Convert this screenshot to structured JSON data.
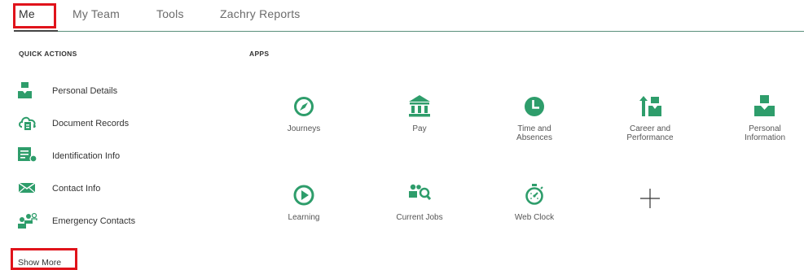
{
  "tabs": [
    {
      "label": "Me",
      "active": true
    },
    {
      "label": "My Team"
    },
    {
      "label": "Tools"
    },
    {
      "label": "Zachry Reports"
    }
  ],
  "accent_color": "#2e9d6b",
  "highlight_color": "#e0131b",
  "quick_actions": {
    "title": "QUICK ACTIONS",
    "items": [
      {
        "label": "Personal Details",
        "icon": "person-icon"
      },
      {
        "label": "Document Records",
        "icon": "cloud-document-icon"
      },
      {
        "label": "Identification Info",
        "icon": "id-card-icon"
      },
      {
        "label": "Contact Info",
        "icon": "envelope-icon"
      },
      {
        "label": "Emergency Contacts",
        "icon": "people-group-icon"
      }
    ],
    "show_more": "Show More"
  },
  "apps": {
    "title": "APPS",
    "items": [
      {
        "label": "Journeys",
        "icon": "compass-icon"
      },
      {
        "label": "Pay",
        "icon": "bank-icon"
      },
      {
        "label": "Time and\nAbsences",
        "icon": "clock-icon"
      },
      {
        "label": "Career and\nPerformance",
        "icon": "career-arrow-person-icon"
      },
      {
        "label": "Personal\nInformation",
        "icon": "person-icon"
      },
      {
        "label": "Learning",
        "icon": "play-circle-icon"
      },
      {
        "label": "Current Jobs",
        "icon": "job-search-icon"
      },
      {
        "label": "Web Clock",
        "icon": "stopwatch-icon"
      }
    ]
  }
}
